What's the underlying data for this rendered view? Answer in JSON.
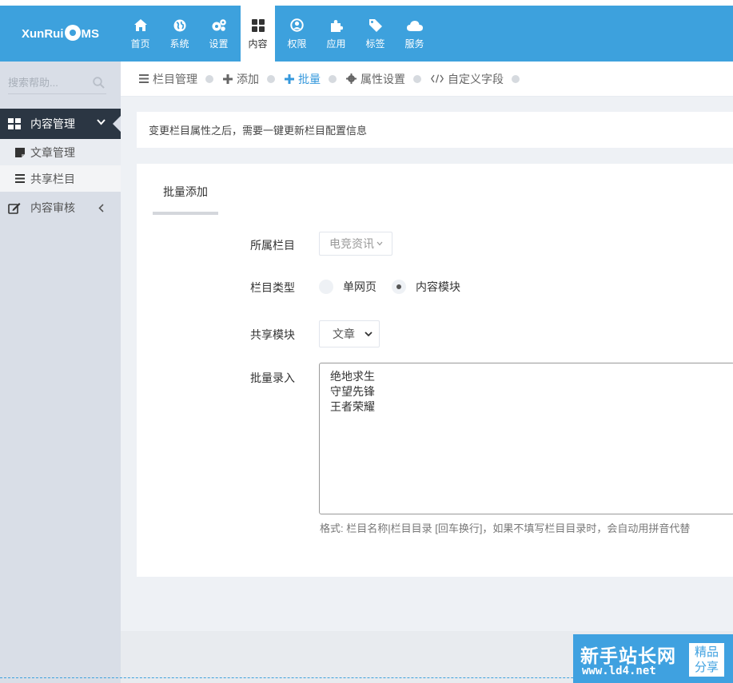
{
  "logo": {
    "text_left": "XunRui",
    "text_right": "MS"
  },
  "nav": [
    {
      "label": "首页",
      "icon": "home-icon"
    },
    {
      "label": "系统",
      "icon": "globe-icon"
    },
    {
      "label": "设置",
      "icon": "gears-icon"
    },
    {
      "label": "内容",
      "icon": "grid-icon",
      "active": true
    },
    {
      "label": "权限",
      "icon": "user-circle-icon"
    },
    {
      "label": "应用",
      "icon": "puzzle-icon"
    },
    {
      "label": "标签",
      "icon": "tag-icon"
    },
    {
      "label": "服务",
      "icon": "cloud-icon"
    }
  ],
  "sidebar": {
    "search_placeholder": "搜索帮助...",
    "active_menu": "内容管理",
    "sub_items": [
      "文章管理",
      "共享栏目"
    ],
    "menu2": "内容审核"
  },
  "tabs": [
    {
      "label": "栏目管理",
      "icon": "list-icon"
    },
    {
      "label": "添加",
      "icon": "plus-icon"
    },
    {
      "label": "批量",
      "icon": "plus-icon",
      "current": true
    },
    {
      "label": "属性设置",
      "icon": "gear-icon"
    },
    {
      "label": "自定义字段",
      "icon": "code-icon"
    }
  ],
  "notice": "变更栏目属性之后，需要一键更新栏目配置信息",
  "panel": {
    "tab": "批量添加",
    "labels": {
      "parent": "所属栏目",
      "type": "栏目类型",
      "module": "共享模块",
      "batch": "批量录入"
    },
    "parent_value": "电竞资讯",
    "radio_single": "单网页",
    "radio_module": "内容模块",
    "module_value": "文章",
    "batch_text": "绝地求生\n守望先锋\n王者荣耀",
    "help": "格式: 栏目名称|栏目目录 [回车换行]，如果不填写栏目目录时，会自动用拼音代替"
  },
  "watermark": {
    "title": "新手站长网",
    "url": "www.ld4.net",
    "badge_top": "精品",
    "badge_bottom": "分享"
  },
  "colors": {
    "topbar": "#3da1dd",
    "sidebar": "#d9dee7",
    "sidebar_active": "#2b3643",
    "link": "#3598dc"
  }
}
